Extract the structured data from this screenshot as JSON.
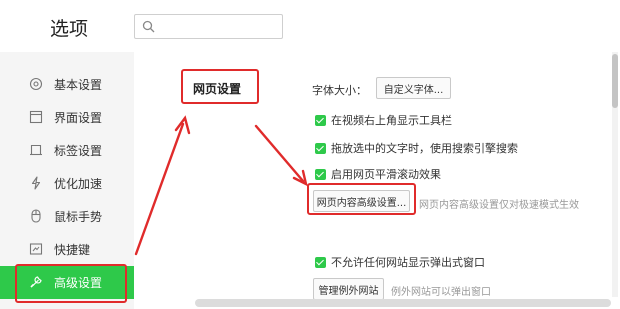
{
  "header": {
    "title": "选项",
    "search_placeholder": ""
  },
  "sidebar": {
    "items": [
      {
        "label": "基本设置",
        "icon": "gear-circle-icon"
      },
      {
        "label": "界面设置",
        "icon": "window-icon"
      },
      {
        "label": "标签设置",
        "icon": "tab-icon"
      },
      {
        "label": "优化加速",
        "icon": "lightning-icon"
      },
      {
        "label": "鼠标手势",
        "icon": "mouse-icon"
      },
      {
        "label": "快捷键",
        "icon": "keyboard-icon"
      },
      {
        "label": "高级设置",
        "icon": "wrench-icon",
        "active": true
      }
    ]
  },
  "main": {
    "section_title": "网页设置",
    "font_size_label": "字体大小：",
    "custom_font_button": "自定义字体...",
    "checkboxes": [
      {
        "label": "在视频右上角显示工具栏",
        "checked": true
      },
      {
        "label": "拖放选中的文字时，使用搜索引擎搜索",
        "checked": true
      },
      {
        "label": "启用网页平滑滚动效果",
        "checked": true
      }
    ],
    "advanced_button": "网页内容高级设置...",
    "advanced_hint": "网页内容高级设置仅对极速模式生效",
    "popup_checkbox": {
      "label": "不允许任何网站显示弹出式窗口",
      "checked": true
    },
    "exceptions_button": "管理例外网站",
    "exceptions_hint": "例外网站可以弹出窗口"
  },
  "colors": {
    "accent": "#2ec94a",
    "annotation": "#e02b2b",
    "sidebar_bg": "#f5f5f5"
  }
}
